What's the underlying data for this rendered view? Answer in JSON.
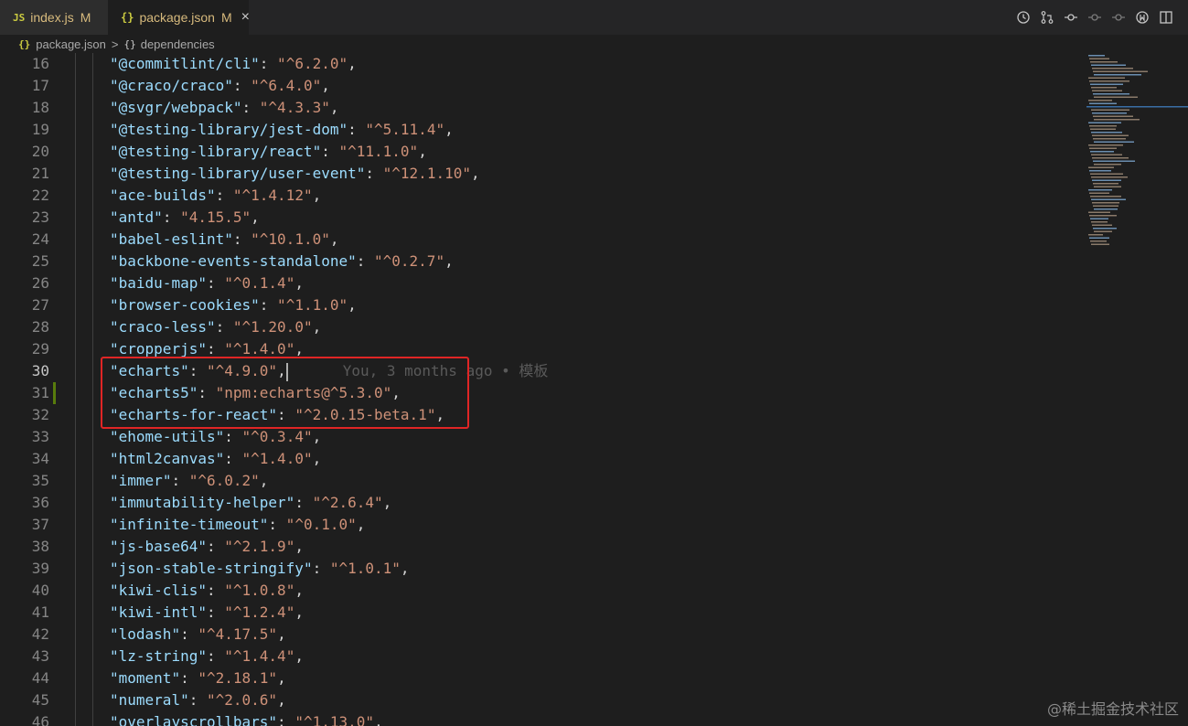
{
  "tabs": [
    {
      "icon": "JS",
      "label": "index.js",
      "status": "M"
    },
    {
      "icon": "{}",
      "label": "package.json",
      "status": "M",
      "close": "×"
    }
  ],
  "breadcrumb": {
    "file_icon": "{}",
    "file": "package.json",
    "separator": ">",
    "section_icon": "{}",
    "section": "dependencies"
  },
  "editor": {
    "lines": [
      {
        "n": "16",
        "key": "@commitlint/cli",
        "value": "^6.2.0"
      },
      {
        "n": "17",
        "key": "@craco/craco",
        "value": "^6.4.0"
      },
      {
        "n": "18",
        "key": "@svgr/webpack",
        "value": "^4.3.3"
      },
      {
        "n": "19",
        "key": "@testing-library/jest-dom",
        "value": "^5.11.4"
      },
      {
        "n": "20",
        "key": "@testing-library/react",
        "value": "^11.1.0"
      },
      {
        "n": "21",
        "key": "@testing-library/user-event",
        "value": "^12.1.10"
      },
      {
        "n": "22",
        "key": "ace-builds",
        "value": "^1.4.12"
      },
      {
        "n": "23",
        "key": "antd",
        "value": "4.15.5"
      },
      {
        "n": "24",
        "key": "babel-eslint",
        "value": "^10.1.0"
      },
      {
        "n": "25",
        "key": "backbone-events-standalone",
        "value": "^0.2.7"
      },
      {
        "n": "26",
        "key": "baidu-map",
        "value": "^0.1.4"
      },
      {
        "n": "27",
        "key": "browser-cookies",
        "value": "^1.1.0"
      },
      {
        "n": "28",
        "key": "craco-less",
        "value": "^1.20.0"
      },
      {
        "n": "29",
        "key": "cropperjs",
        "value": "^1.4.0"
      },
      {
        "n": "30",
        "key": "echarts",
        "value": "^4.9.0"
      },
      {
        "n": "31",
        "key": "echarts5",
        "value": "npm:echarts@^5.3.0"
      },
      {
        "n": "32",
        "key": "echarts-for-react",
        "value": "^2.0.15-beta.1"
      },
      {
        "n": "33",
        "key": "ehome-utils",
        "value": "^0.3.4"
      },
      {
        "n": "34",
        "key": "html2canvas",
        "value": "^1.4.0"
      },
      {
        "n": "35",
        "key": "immer",
        "value": "^6.0.2"
      },
      {
        "n": "36",
        "key": "immutability-helper",
        "value": "^2.6.4"
      },
      {
        "n": "37",
        "key": "infinite-timeout",
        "value": "^0.1.0"
      },
      {
        "n": "38",
        "key": "js-base64",
        "value": "^2.1.9"
      },
      {
        "n": "39",
        "key": "json-stable-stringify",
        "value": "^1.0.1"
      },
      {
        "n": "40",
        "key": "kiwi-clis",
        "value": "^1.0.8"
      },
      {
        "n": "41",
        "key": "kiwi-intl",
        "value": "^1.2.4"
      },
      {
        "n": "42",
        "key": "lodash",
        "value": "^4.17.5"
      },
      {
        "n": "43",
        "key": "lz-string",
        "value": "^1.4.4"
      },
      {
        "n": "44",
        "key": "moment",
        "value": "^2.18.1"
      },
      {
        "n": "45",
        "key": "numeral",
        "value": "^2.0.6"
      },
      {
        "n": "46",
        "key": "overlayscrollbars",
        "value": "^1.13.0"
      }
    ],
    "blame": "You, 3 months ago • 模板"
  },
  "watermark": "@稀土掘金技术社区",
  "icons": [
    "history-icon",
    "source-control-icon",
    "git-commit-icon",
    "go-back-icon",
    "go-forward-icon",
    "timeline-icon",
    "split-editor-icon",
    "close-icon",
    "json-file-icon",
    "js-file-icon"
  ]
}
